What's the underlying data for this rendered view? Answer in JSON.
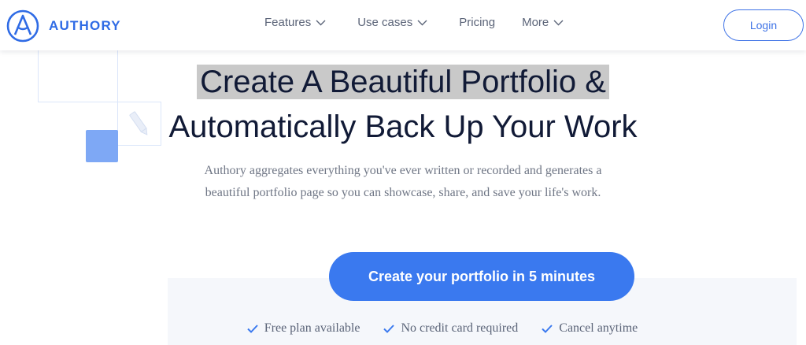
{
  "brand": {
    "name": "AUTHORY",
    "color": "#2f6be5"
  },
  "nav": {
    "items": [
      {
        "label": "Features",
        "dropdown": true
      },
      {
        "label": "Use cases",
        "dropdown": true
      },
      {
        "label": "Pricing",
        "dropdown": false
      },
      {
        "label": "More",
        "dropdown": true
      }
    ],
    "login_label": "Login"
  },
  "hero": {
    "title_line1": "Create A Beautiful Portfolio &",
    "title_line2": "Automatically Back Up Your Work",
    "subtitle_line1": "Authory aggregates everything you've ever written or recorded and generates a",
    "subtitle_line2": "beautiful portfolio page so you can showcase, share, and save your life's work.",
    "cta_label": "Create your portfolio in 5 minutes",
    "accent_color": "#3a79ef"
  },
  "features": [
    {
      "label": "Free plan available",
      "icon": "check-icon"
    },
    {
      "label": "No credit card required",
      "icon": "check-icon"
    },
    {
      "label": "Cancel anytime",
      "icon": "check-icon"
    }
  ]
}
